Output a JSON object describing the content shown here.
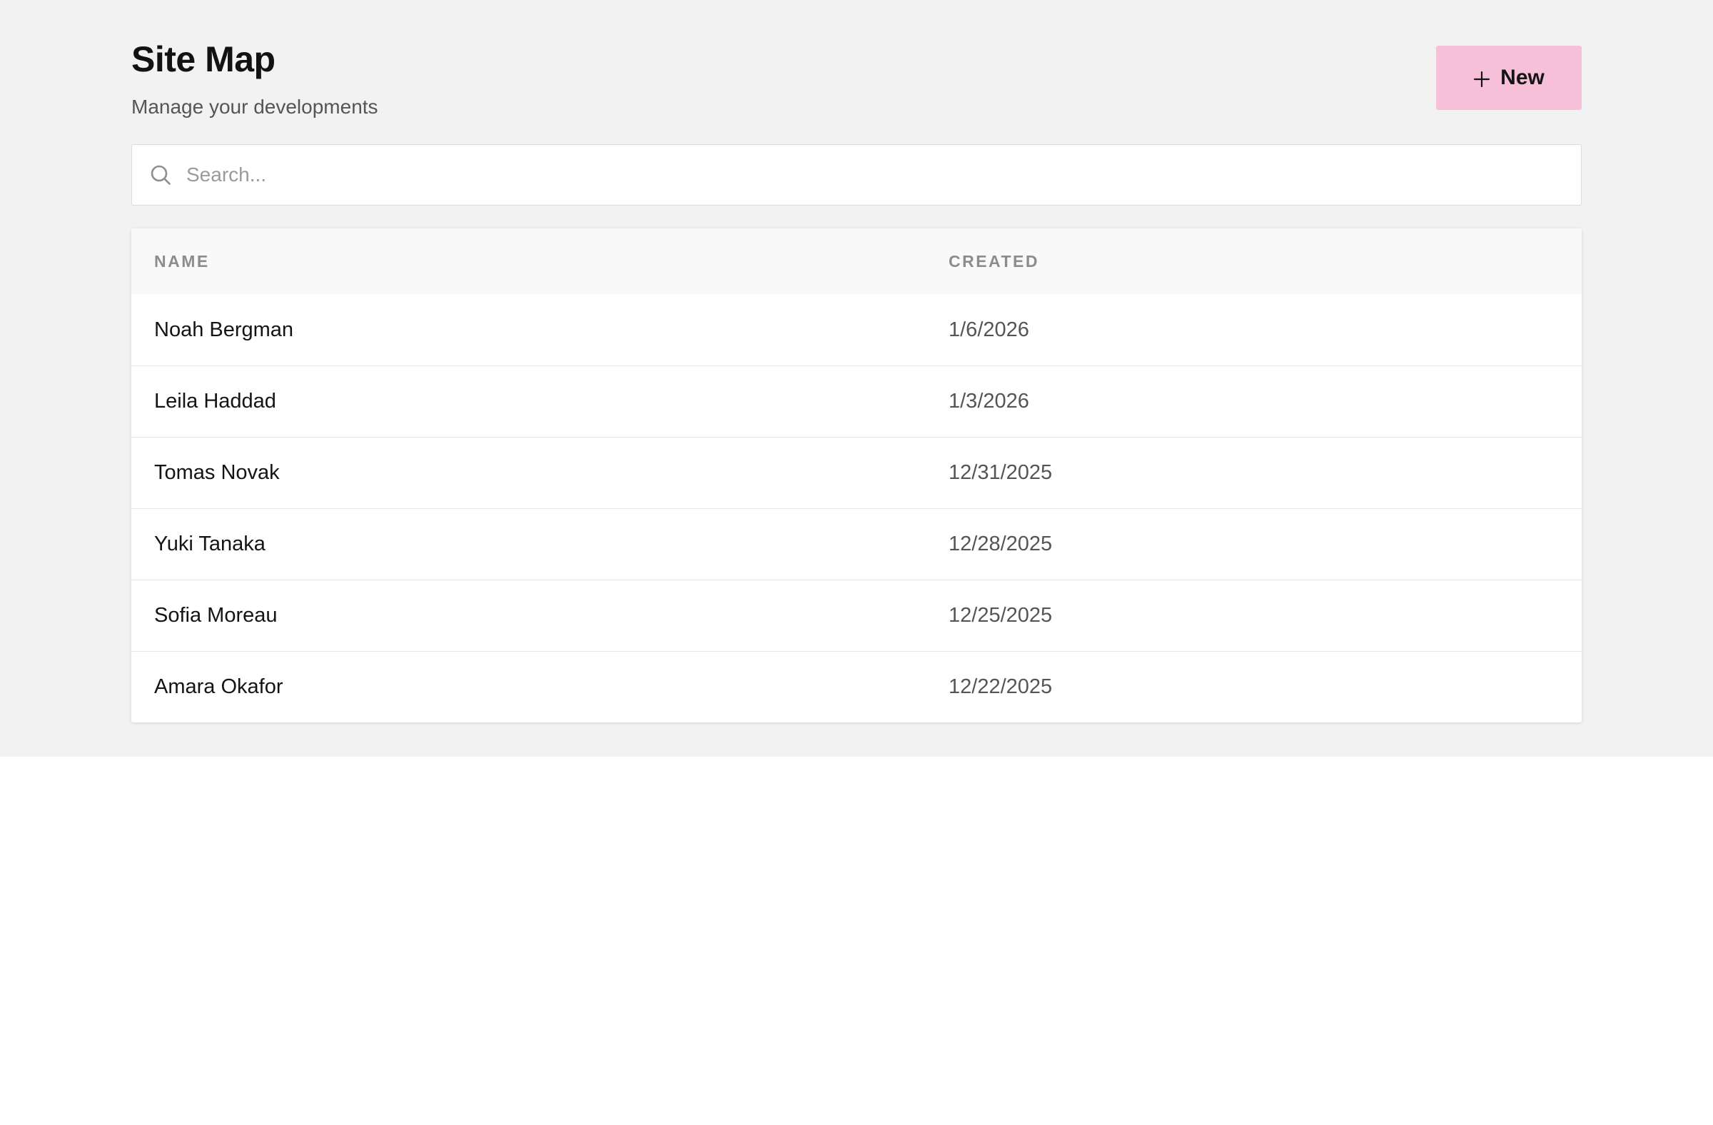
{
  "header": {
    "title": "Site Map",
    "subtitle": "Manage your developments",
    "new_button_label": "New",
    "new_button_icon": "plus-icon"
  },
  "search": {
    "placeholder": "Search...",
    "value": "",
    "icon": "search-icon"
  },
  "table": {
    "columns": [
      "NAME",
      "CREATED"
    ],
    "rows": [
      {
        "name": "Noah Bergman",
        "created": "1/6/2026"
      },
      {
        "name": "Leila Haddad",
        "created": "1/3/2026"
      },
      {
        "name": "Tomas Novak",
        "created": "12/31/2025"
      },
      {
        "name": "Yuki Tanaka",
        "created": "12/28/2025"
      },
      {
        "name": "Sofia Moreau",
        "created": "12/25/2025"
      },
      {
        "name": "Amara Okafor",
        "created": "12/22/2025"
      }
    ]
  },
  "colors": {
    "page_background": "#f2f2f2",
    "accent_button": "#f6c1d8",
    "header_row": "#f9f9f9"
  }
}
